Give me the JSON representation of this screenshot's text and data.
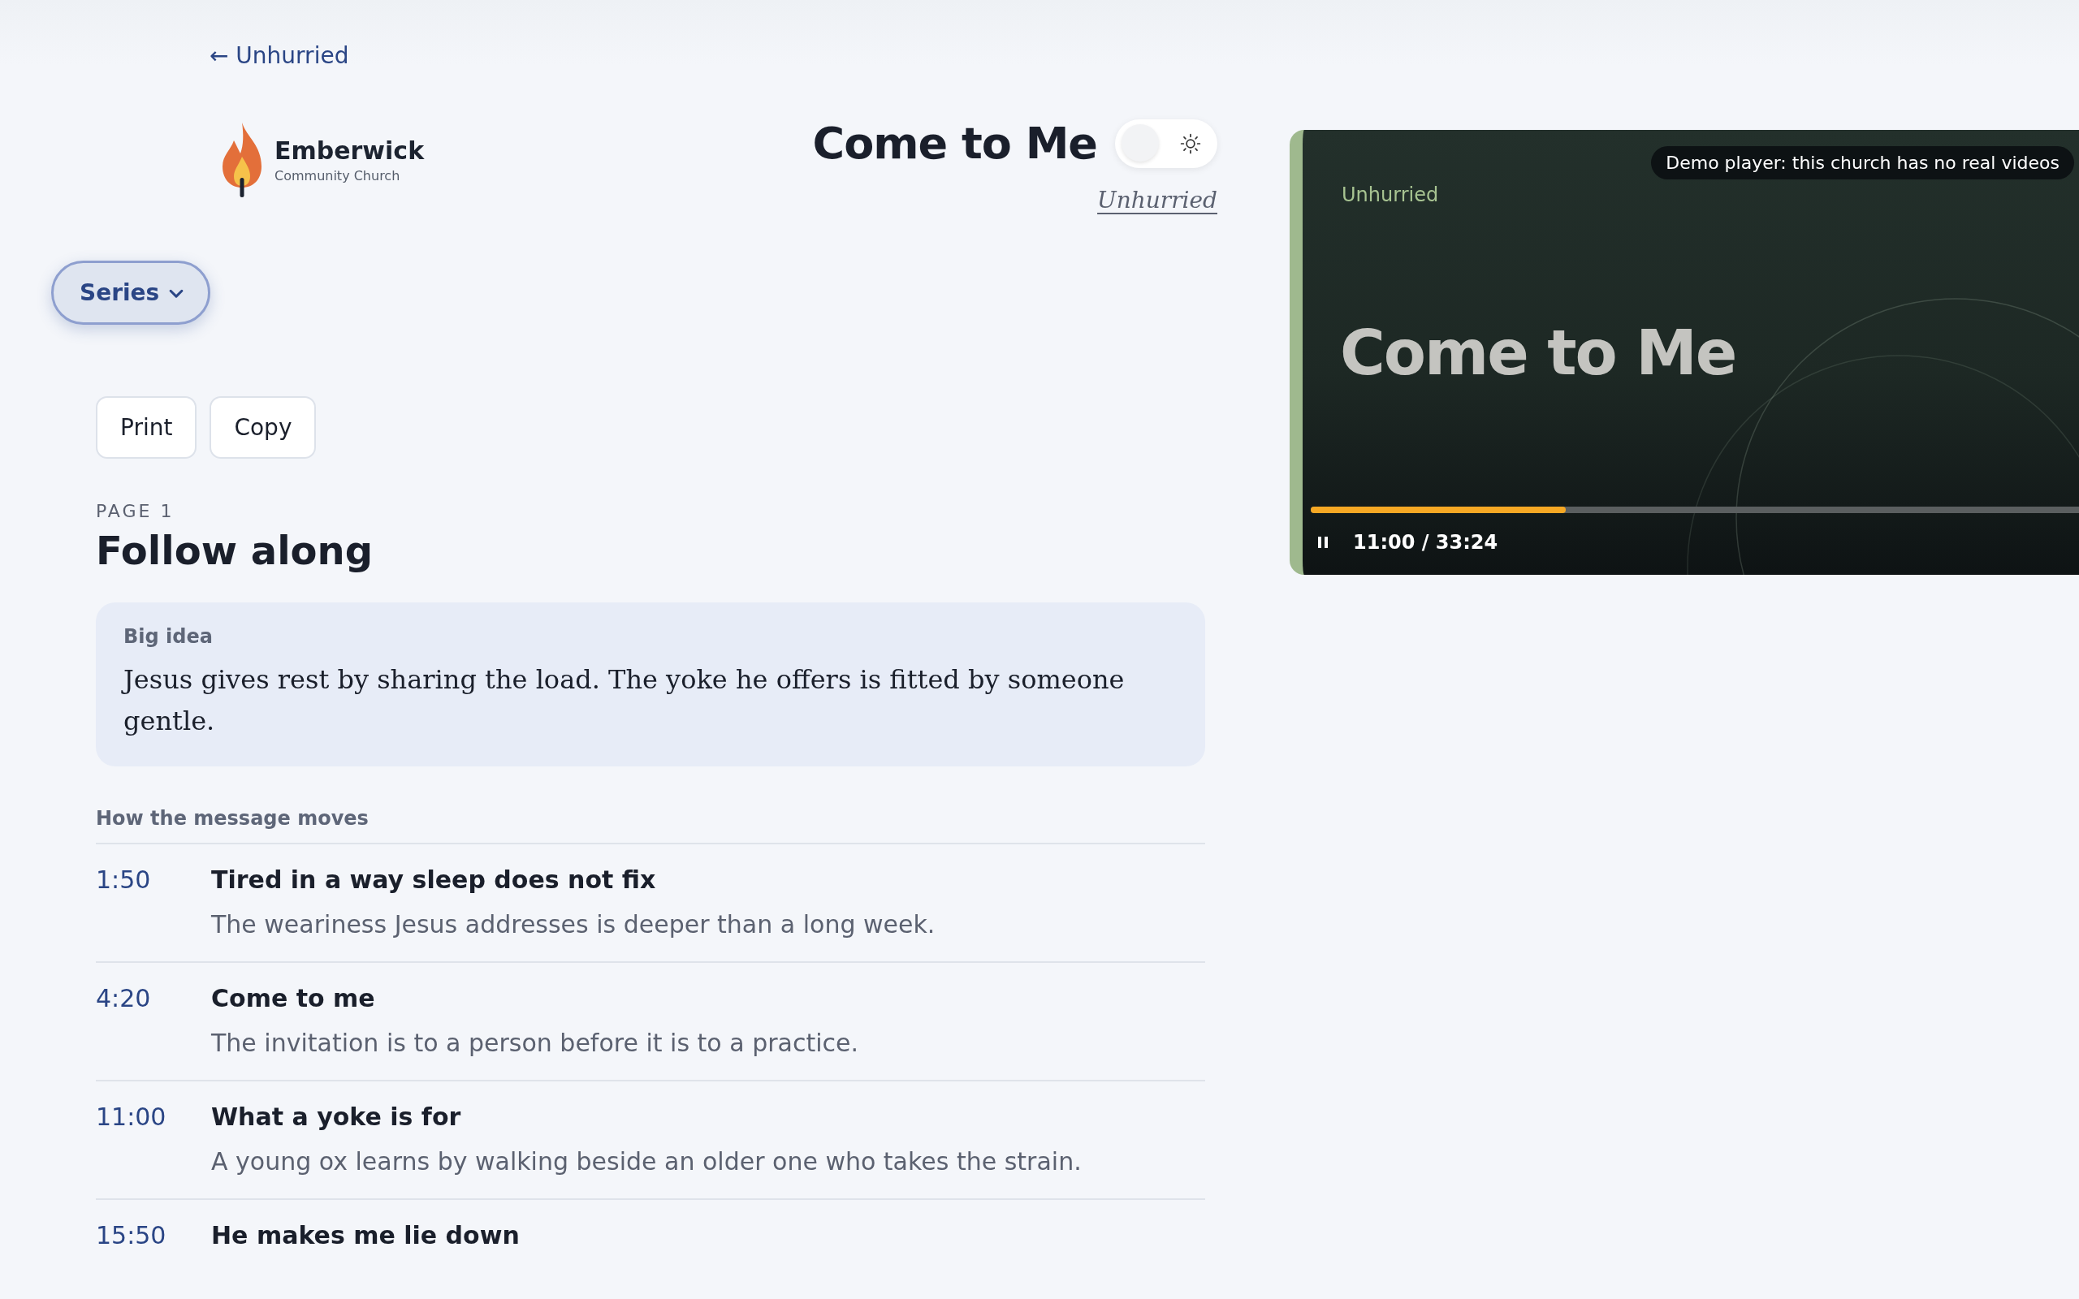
{
  "back_link": {
    "arrow": "←",
    "label": "Unhurried"
  },
  "church": {
    "name": "Emberwick",
    "subtitle": "Community Church"
  },
  "sermon": {
    "title": "Come to Me",
    "series_link": "Unhurried",
    "dark_mode": false
  },
  "series_button": {
    "label": "Series"
  },
  "actions": [
    "Print",
    "Copy"
  ],
  "page": {
    "eyebrow": "PAGE 1",
    "heading": "Follow along"
  },
  "big_idea": {
    "label": "Big idea",
    "text": "Jesus gives rest by sharing the load. The yoke he offers is fitted by someone gentle."
  },
  "outline": {
    "heading": "How the message moves",
    "items": [
      {
        "time": "1:50",
        "title": "Tired in a way sleep does not fix",
        "description": "The weariness Jesus addresses is deeper than a long week."
      },
      {
        "time": "4:20",
        "title": "Come to me",
        "description": "The invitation is to a person before it is to a practice."
      },
      {
        "time": "11:00",
        "title": "What a yoke is for",
        "description": "A young ox learns by walking beside an older one who takes the strain."
      },
      {
        "time": "15:50",
        "title": "He makes me lie down"
      }
    ]
  },
  "player": {
    "notice": "Demo player: this church has no real videos",
    "series": "Unhurried",
    "title": "Come to Me",
    "playing": true,
    "level": 0.33,
    "time": "11:00 / 33:24"
  }
}
